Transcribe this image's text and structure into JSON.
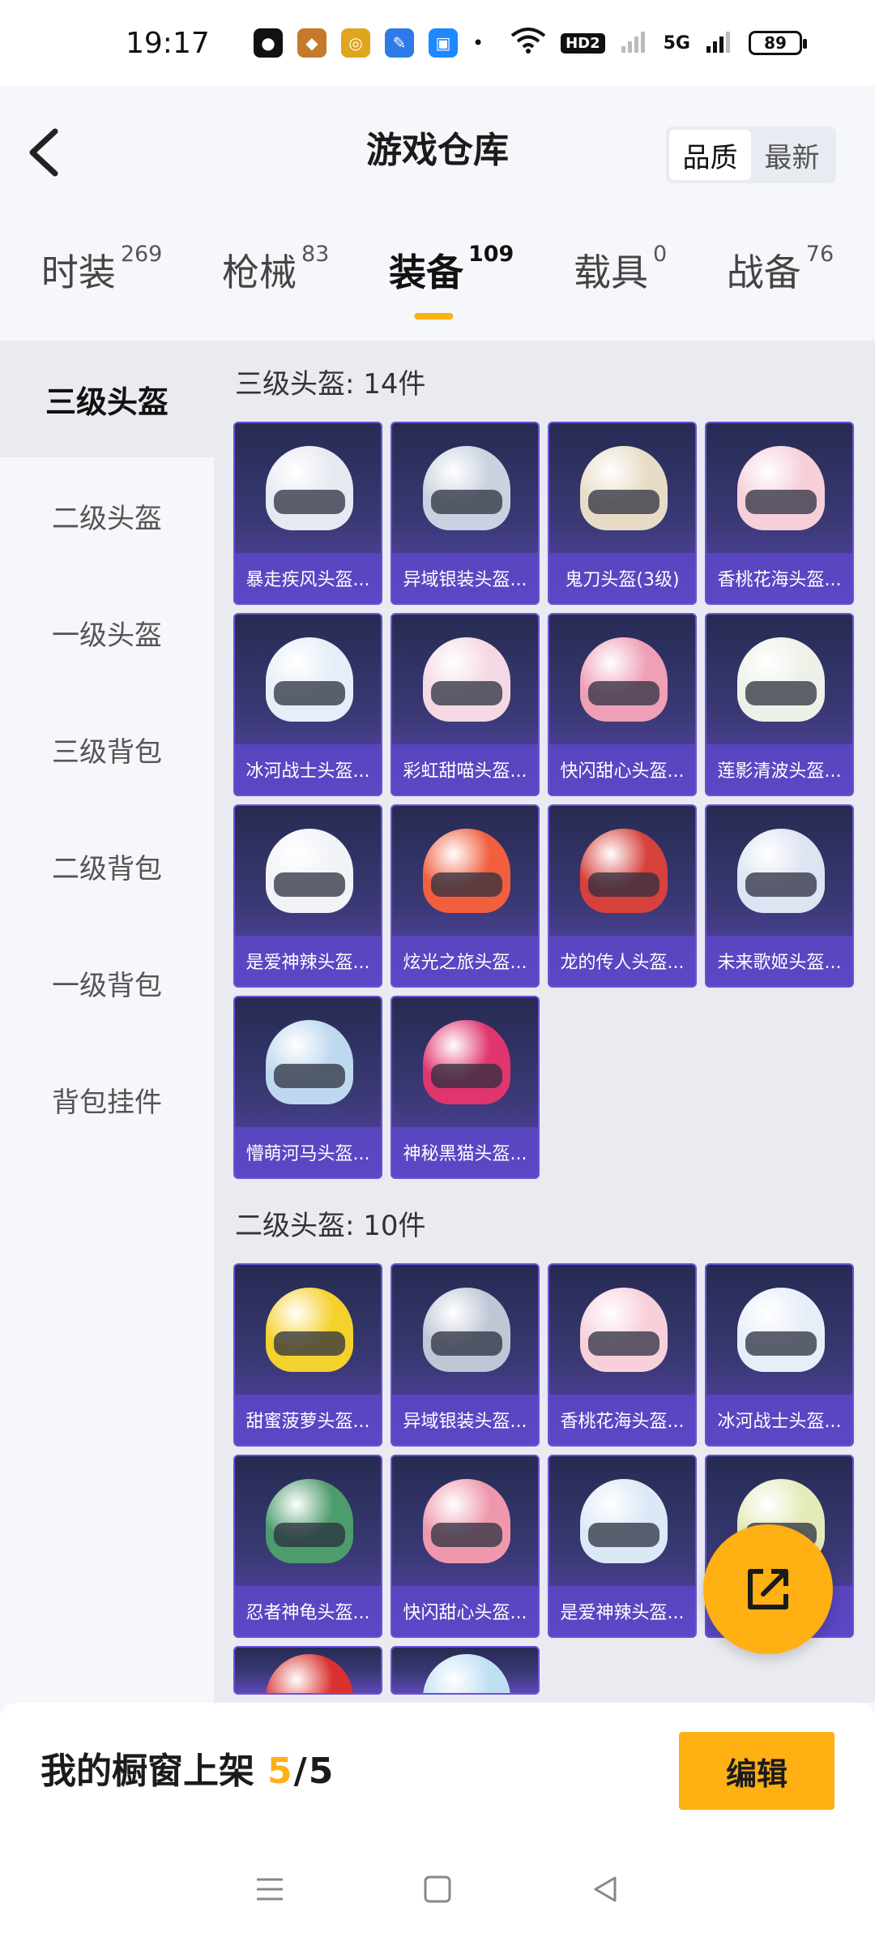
{
  "status_bar": {
    "time": "19:17",
    "network": "5G",
    "battery": "89",
    "badges": {
      "hd": "HD2"
    },
    "apps": [
      {
        "icon": "wechat-icon",
        "color": "#111111"
      },
      {
        "icon": "game-app-icon",
        "color": "#c57a2a"
      },
      {
        "icon": "coin-app-icon",
        "color": "#e1a41d"
      },
      {
        "icon": "feather-app-icon",
        "color": "#2d7ae8"
      },
      {
        "icon": "browser-app-icon",
        "color": "#1e88ff"
      }
    ]
  },
  "header": {
    "title": "游戏仓库",
    "sort_options": [
      "品质",
      "最新"
    ],
    "active_sort": "品质"
  },
  "tabs": [
    {
      "label": "时装",
      "count": "269"
    },
    {
      "label": "枪械",
      "count": "83"
    },
    {
      "label": "装备",
      "count": "109",
      "active": true
    },
    {
      "label": "载具",
      "count": "0"
    },
    {
      "label": "战备",
      "count": "76"
    }
  ],
  "sidebar": {
    "items": [
      "三级头盔",
      "二级头盔",
      "一级头盔",
      "三级背包",
      "二级背包",
      "一级背包",
      "背包挂件"
    ],
    "active_index": 0
  },
  "sections": [
    {
      "title": "三级头盔: 14件",
      "items": [
        {
          "name": "暴走疾风头盔...",
          "color": "#e7e9f2"
        },
        {
          "name": "异域银装头盔...",
          "color": "#c9d2e0"
        },
        {
          "name": "鬼刀头盔(3级)",
          "color": "#e7dcc6"
        },
        {
          "name": "香桃花海头盔...",
          "color": "#f6cfd9"
        },
        {
          "name": "冰河战士头盔...",
          "color": "#e6eef8"
        },
        {
          "name": "彩虹甜喵头盔...",
          "color": "#f4d8e4"
        },
        {
          "name": "快闪甜心头盔...",
          "color": "#ef9fb6"
        },
        {
          "name": "莲影清波头盔...",
          "color": "#eef1e7"
        },
        {
          "name": "是爱神辣头盔...",
          "color": "#f1f3f7"
        },
        {
          "name": "炫光之旅头盔...",
          "color": "#f15f3f"
        },
        {
          "name": "龙的传人头盔...",
          "color": "#d7413c"
        },
        {
          "name": "未来歌姬头盔...",
          "color": "#dde4f2"
        },
        {
          "name": "懵萌河马头盔...",
          "color": "#bed9ef"
        },
        {
          "name": "神秘黑猫头盔...",
          "color": "#e1356f"
        }
      ]
    },
    {
      "title": "二级头盔: 10件",
      "items": [
        {
          "name": "甜蜜菠萝头盔...",
          "color": "#f5d12e"
        },
        {
          "name": "异域银装头盔...",
          "color": "#bfc7d6"
        },
        {
          "name": "香桃花海头盔...",
          "color": "#f8d0da"
        },
        {
          "name": "冰河战士头盔...",
          "color": "#e8eef8"
        },
        {
          "name": "忍者神龟头盔...",
          "color": "#4d9c6c"
        },
        {
          "name": "快闪甜心头盔...",
          "color": "#ef98ad"
        },
        {
          "name": "是爱神辣头盔...",
          "color": "#dbe9f7"
        },
        {
          "name": "...",
          "color": "#e4ebb9"
        },
        {
          "name": "",
          "color": "#d8312f"
        },
        {
          "name": "",
          "color": "#bfe0f3"
        }
      ]
    }
  ],
  "bottom_bar": {
    "label": "我的橱窗上架",
    "current": "5",
    "total": "5",
    "edit_button": "编辑"
  },
  "colors": {
    "accent": "#ffb013",
    "card_border": "#6b51d8",
    "card_label_bg": "#5d46c8"
  }
}
